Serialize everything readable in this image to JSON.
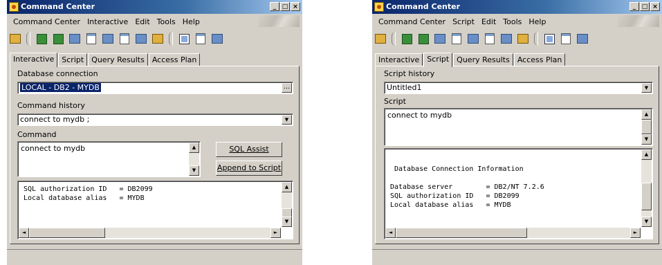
{
  "left_window": {
    "title": "Command Center",
    "menu": [
      "Command Center",
      "Interactive",
      "Edit",
      "Tools",
      "Help"
    ],
    "tabs": [
      "Interactive",
      "Script",
      "Query Results",
      "Access Plan"
    ],
    "active_tab": "Interactive",
    "db_connection_label": "Database connection",
    "db_connection_value": "LOCAL - DB2 - MYDB",
    "browse_button": "...",
    "command_history_label": "Command history",
    "command_history_value": "connect to mydb ;",
    "command_label": "Command",
    "command_text": "connect to mydb",
    "sql_assist_button": "SQL Assist",
    "append_button": "Append to Script",
    "output_lines": [
      "SQL authorization ID   = DB2099",
      "Local database alias   = MYDB"
    ]
  },
  "right_window": {
    "title": "Command Center",
    "menu": [
      "Command Center",
      "Script",
      "Edit",
      "Tools",
      "Help"
    ],
    "tabs": [
      "Interactive",
      "Script",
      "Query Results",
      "Access Plan"
    ],
    "active_tab": "Script",
    "script_history_label": "Script history",
    "script_history_value": "Untitled1",
    "script_label": "Script",
    "script_text": "connect to mydb",
    "output_lines": [
      "Database Connection Information",
      "Database server        = DB2/NT 7.2.6",
      "SQL authorization ID   = DB2099",
      "Local database alias   = MYDB"
    ]
  },
  "icons": {
    "minimize": "_",
    "maximize": "□",
    "close": "×",
    "arrow_up": "▲",
    "arrow_down": "▼",
    "arrow_left": "◄",
    "arrow_right": "►"
  }
}
